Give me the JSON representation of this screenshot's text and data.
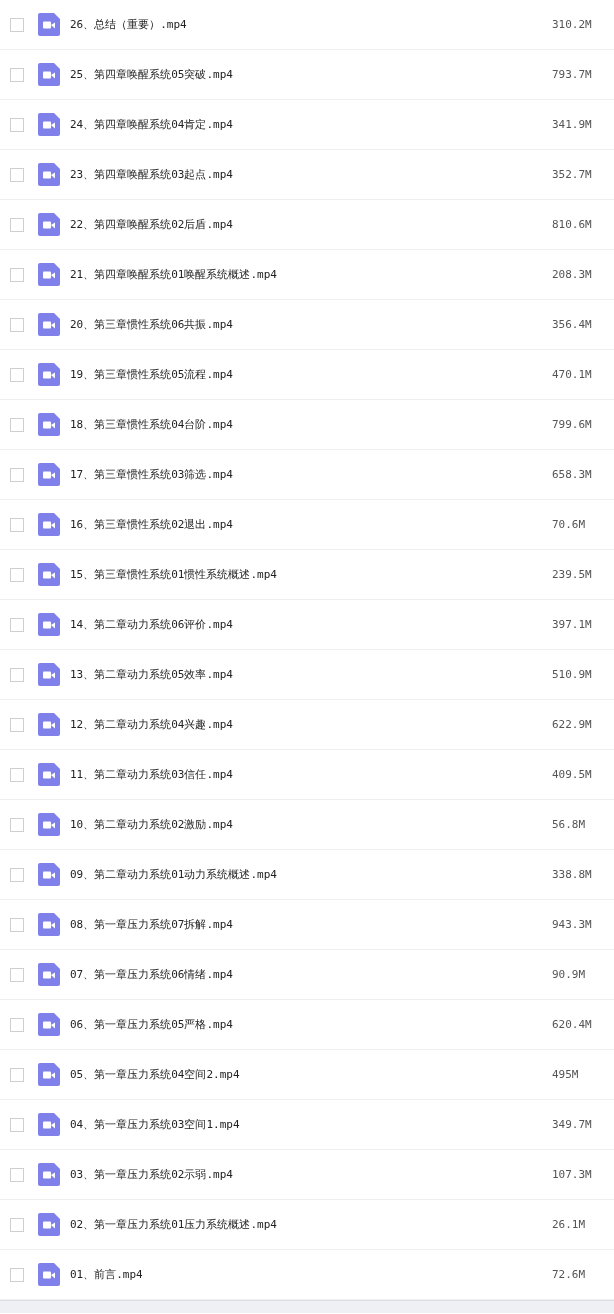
{
  "files": [
    {
      "name": "26、总结（重要）.mp4",
      "size": "310.2M",
      "checked": false
    },
    {
      "name": "25、第四章唤醒系统05突破.mp4",
      "size": "793.7M",
      "checked": false
    },
    {
      "name": "24、第四章唤醒系统04肯定.mp4",
      "size": "341.9M",
      "checked": false
    },
    {
      "name": "23、第四章唤醒系统03起点.mp4",
      "size": "352.7M",
      "checked": false
    },
    {
      "name": "22、第四章唤醒系统02后盾.mp4",
      "size": "810.6M",
      "checked": false
    },
    {
      "name": "21、第四章唤醒系统01唤醒系统概述.mp4",
      "size": "208.3M",
      "checked": false
    },
    {
      "name": "20、第三章惯性系统06共振.mp4",
      "size": "356.4M",
      "checked": false
    },
    {
      "name": "19、第三章惯性系统05流程.mp4",
      "size": "470.1M",
      "checked": false
    },
    {
      "name": "18、第三章惯性系统04台阶.mp4",
      "size": "799.6M",
      "checked": false
    },
    {
      "name": "17、第三章惯性系统03筛选.mp4",
      "size": "658.3M",
      "checked": false
    },
    {
      "name": "16、第三章惯性系统02退出.mp4",
      "size": "70.6M",
      "checked": false
    },
    {
      "name": "15、第三章惯性系统01惯性系统概述.mp4",
      "size": "239.5M",
      "checked": false
    },
    {
      "name": "14、第二章动力系统06评价.mp4",
      "size": "397.1M",
      "checked": false
    },
    {
      "name": "13、第二章动力系统05效率.mp4",
      "size": "510.9M",
      "checked": false
    },
    {
      "name": "12、第二章动力系统04兴趣.mp4",
      "size": "622.9M",
      "checked": false
    },
    {
      "name": "11、第二章动力系统03信任.mp4",
      "size": "409.5M",
      "checked": false
    },
    {
      "name": "10、第二章动力系统02激励.mp4",
      "size": "56.8M",
      "checked": false
    },
    {
      "name": "09、第二章动力系统01动力系统概述.mp4",
      "size": "338.8M",
      "checked": false
    },
    {
      "name": "08、第一章压力系统07拆解.mp4",
      "size": "943.3M",
      "checked": false
    },
    {
      "name": "07、第一章压力系统06情绪.mp4",
      "size": "90.9M",
      "checked": false
    },
    {
      "name": "06、第一章压力系统05严格.mp4",
      "size": "620.4M",
      "checked": false
    },
    {
      "name": "05、第一章压力系统04空间2.mp4",
      "size": "495M",
      "checked": false
    },
    {
      "name": "04、第一章压力系统03空间1.mp4",
      "size": "349.7M",
      "checked": false
    },
    {
      "name": "03、第一章压力系统02示弱.mp4",
      "size": "107.3M",
      "checked": false
    },
    {
      "name": "02、第一章压力系统01压力系统概述.mp4",
      "size": "26.1M",
      "checked": false
    },
    {
      "name": "01、前言.mp4",
      "size": "72.6M",
      "checked": false
    }
  ]
}
